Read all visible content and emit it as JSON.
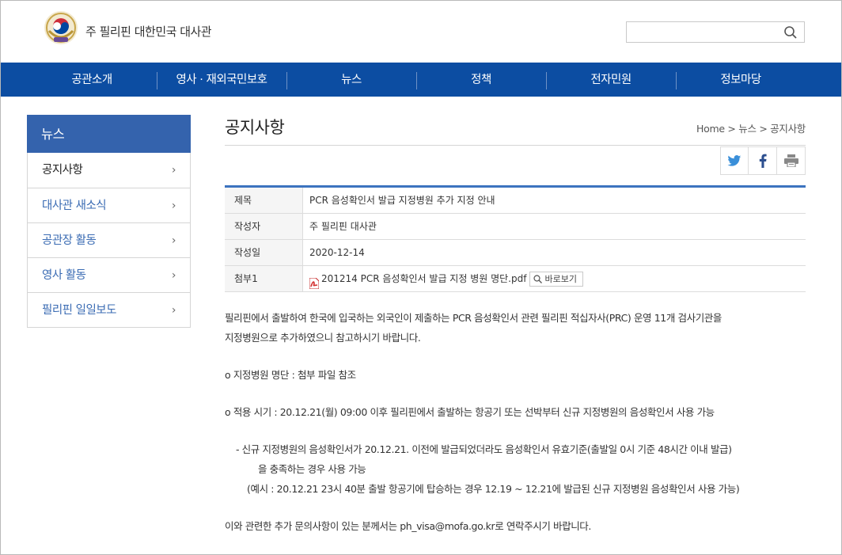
{
  "header": {
    "site_title": "주 필리핀 대한민국 대사관",
    "search_placeholder": ""
  },
  "gnb": {
    "items": [
      "공관소개",
      "영사 · 재외국민보호",
      "뉴스",
      "정책",
      "전자민원",
      "정보마당"
    ]
  },
  "lnb": {
    "title": "뉴스",
    "items": [
      {
        "label": "공지사항"
      },
      {
        "label": "대사관 새소식"
      },
      {
        "label": "공관장 활동"
      },
      {
        "label": "영사 활동"
      },
      {
        "label": "필리핀 일일보도"
      }
    ]
  },
  "content": {
    "page_title": "공지사항",
    "breadcrumb": "Home > 뉴스 > 공지사항",
    "fields": {
      "subject_label": "제목",
      "subject": "PCR 음성확인서 발급 지정병원 추가 지정 안내",
      "author_label": "작성자",
      "author": "주 필리핀 대사관",
      "date_label": "작성일",
      "date": "2020-12-14",
      "attach_label": "첨부1",
      "attachment": "201214 PCR 음성확인서 발급 지정 병원 명단.pdf",
      "preview_label": "바로보기"
    },
    "body": {
      "p1": "필리핀에서 출발하여 한국에 입국하는 외국인이 제출하는 PCR 음성확인서 관련  필리핀 적십자사(PRC) 운영 11개 검사기관을",
      "p1b": "지정병원으로 추가하였으니 참고하시기 바랍니다.",
      "p2": "o 지정병원 명단 : 첨부 파일 참조",
      "p3": "o 적용 시기 : 20.12.21(월) 09:00 이후 필리핀에서 출발하는 항공기 또는 선박부터 신규 지정병원의 음성확인서 사용 가능",
      "p4": "- 신규 지정병원의 음성확인서가 20.12.21. 이전에 발급되었더라도 음성확인서 유효기준(출발일 0시 기준 48시간 이내 발급)",
      "p4b": "을 충족하는 경우 사용 가능",
      "p4c": "(예시 : 20.12.21 23시 40분 출발 항공기에 탑승하는 경우 12.19 ~ 12.21에 발급된 신규 지정병원 음성확인서 사용 가능)",
      "p5": "이와 관련한 추가 문의사항이 있는 분께서는 ph_visa@mofa.go.kr로 연락주시기 바랍니다."
    }
  },
  "colors": {
    "nav_blue": "#0c4da2",
    "lnb_title_blue": "#3463ad",
    "table_top_border": "#3c73bf",
    "twitter": "#3a8fd9",
    "facebook": "#2c4f8f"
  },
  "icons": {
    "logo": "emblem-logo",
    "search": "search-icon",
    "twitter": "twitter-icon",
    "facebook": "facebook-icon",
    "print": "print-icon",
    "pdf": "pdf-icon",
    "magnifier": "magnifier-icon",
    "chevron": "chevron-right-icon"
  }
}
